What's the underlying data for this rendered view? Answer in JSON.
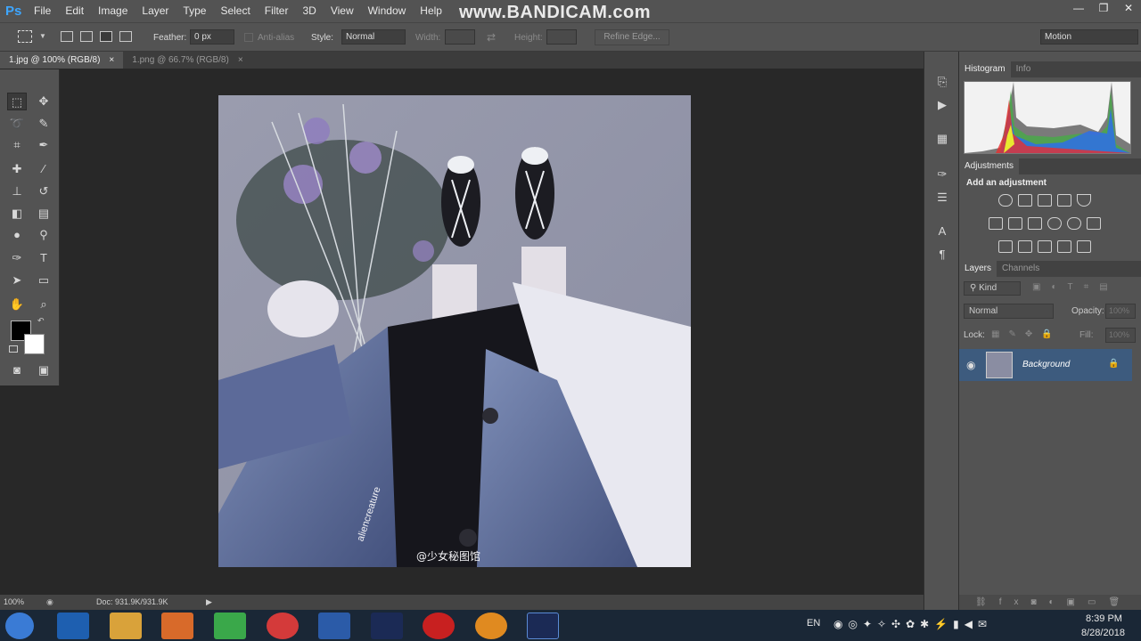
{
  "app": {
    "logo": "Ps",
    "watermark": "www.BANDICAM.com"
  },
  "menu": [
    "File",
    "Edit",
    "Image",
    "Layer",
    "Type",
    "Select",
    "Filter",
    "3D",
    "View",
    "Window",
    "Help"
  ],
  "window_controls": [
    "—",
    "❐",
    "✕"
  ],
  "options": {
    "feather_label": "Feather:",
    "feather_value": "0 px",
    "antialias_label": "Anti-alias",
    "style_label": "Style:",
    "style_value": "Normal",
    "width_label": "Width:",
    "height_label": "Height:",
    "refine_edge": "Refine Edge...",
    "workspace": "Motion"
  },
  "tabs": [
    {
      "label": "1.jpg @ 100% (RGB/8)",
      "close": "×"
    },
    {
      "label": "1.png @ 66.7% (RGB/8)",
      "close": "×"
    }
  ],
  "canvas": {
    "watermark_text": "aliencreature",
    "caption": "@少女秘图馆"
  },
  "status": {
    "zoom": "100%",
    "doc": "Doc: 931.9K/931.9K"
  },
  "panels": {
    "histogram_tab": "Histogram",
    "info_tab": "Info",
    "adjustments_tab": "Adjustments",
    "add_adjustment": "Add an adjustment",
    "layers_tab": "Layers",
    "channels_tab": "Channels",
    "kind": "Kind",
    "blend_mode": "Normal",
    "opacity_label": "Opacity:",
    "opacity_value": "100%",
    "lock_label": "Lock:",
    "fill_label": "Fill:",
    "fill_value": "100%",
    "layer_name": "Background"
  },
  "tray": {
    "lang": "EN",
    "time": "8:39 PM",
    "date": "8/28/2018"
  }
}
